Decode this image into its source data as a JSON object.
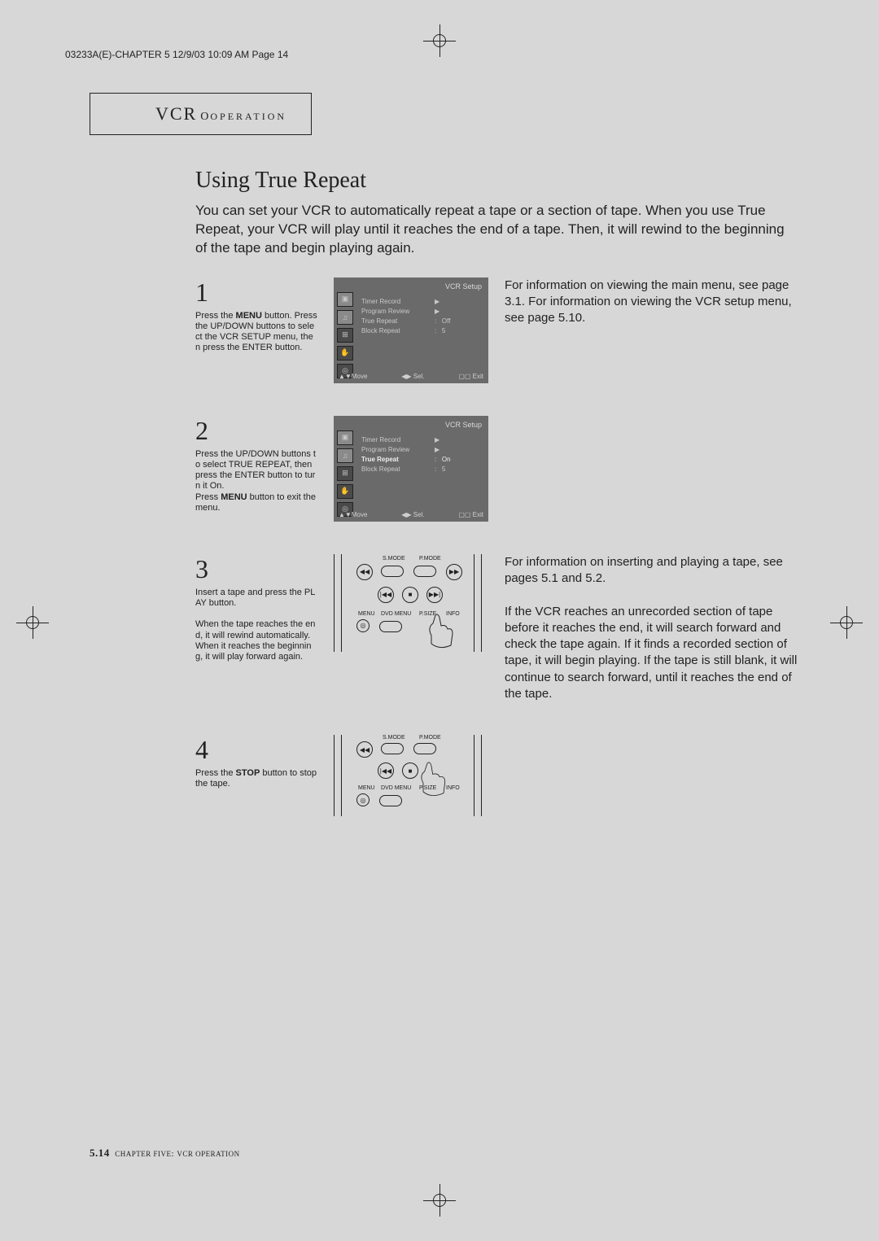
{
  "header_line": "03233A(E)-CHAPTER 5  12/9/03  10:09 AM  Page 14",
  "section_vcr": "VCR",
  "section_op": "OPERATION",
  "title": "Using True Repeat",
  "intro": "You can set your VCR to automatically repeat a tape or a section of tape. When you use True Repeat, your VCR will play until it reaches the end of a tape. Then, it will rewind to the beginning of the tape and begin playing again.",
  "steps": {
    "s1": {
      "num": "1",
      "text_a": "Press the ",
      "text_b": "MENU",
      "text_c": " button. Press the UP/DOWN buttons to select the VCR SETUP menu, then press the ENTER button.",
      "right": "For information on viewing the main menu, see page 3.1. For information on viewing the VCR setup menu, see page 5.10."
    },
    "s2": {
      "num": "2",
      "text_a": "Press the UP/DOWN buttons to select TRUE REPEAT, then press the ENTER button to turn it On.",
      "text_b": "Press ",
      "text_c": "MENU",
      "text_d": " button to exit the menu."
    },
    "s3": {
      "num": "3",
      "text_a": "Insert a tape and press the PLAY button.",
      "text_b": "When the tape reaches the end, it will rewind automatically. When it reaches the beginning, it will play forward again.",
      "right": "For information on inserting and playing a tape, see pages 5.1 and 5.2.",
      "right2": "If the VCR reaches an unrecorded section of tape before it reaches the end, it will search forward and check the tape again. If it finds a recorded section of tape, it will begin playing. If the tape is still blank, it will continue to search forward, until it reaches the end of the tape."
    },
    "s4": {
      "num": "4",
      "text_a": "Press the ",
      "text_b": "STOP",
      "text_c": " button to stop the tape."
    }
  },
  "osd": {
    "title": "VCR Setup",
    "items": {
      "timer": "Timer Record",
      "program": "Program Review",
      "true_repeat": "True Repeat",
      "block_repeat": "Block Repeat"
    },
    "off": "Off",
    "on": "On",
    "five": "5",
    "foot_move": "▲▼Move",
    "foot_sel": "◀▶ Sel.",
    "foot_exit": "▢▢ Exit"
  },
  "remote": {
    "smode": "S.MODE",
    "pmode": "P.MODE",
    "menu": "MENU",
    "dvdmenu": "DVD MENU",
    "psize": "P.SIZE",
    "info": "INFO",
    "rew": "◀◀",
    "ff": "▶▶",
    "prev": "|◀◀",
    "stop": "■",
    "next": "▶▶|"
  },
  "footer": {
    "num": "5.14",
    "chapter": "CHAPTER FIVE",
    "sep": ": ",
    "title": "VCR OPERATION"
  }
}
